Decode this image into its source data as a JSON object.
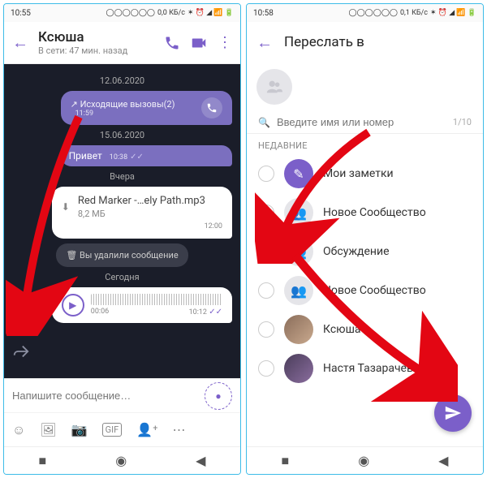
{
  "left": {
    "status": {
      "time": "10:55",
      "net": "0,0 КБ/с"
    },
    "chat_name": "Ксюша",
    "chat_sub": "В сети: 47 мин. назад",
    "dates": {
      "d1": "12.06.2020",
      "d2": "15.06.2020",
      "d3": "Вчера",
      "d4": "Сегодня"
    },
    "call": {
      "text": "Исходящие вызовы(2)",
      "time": "11:59"
    },
    "msg_hello": {
      "text": "Привет",
      "time": "10:38"
    },
    "file": {
      "name": "Red Marker -…ely Path.mp3",
      "size": "8,2 МБ",
      "time": "12:00"
    },
    "deleted": "Вы удалили сообщение",
    "voice": {
      "dur": "00:06",
      "time": "10:12"
    },
    "input_placeholder": "Напишите сообщение…"
  },
  "right": {
    "status": {
      "time": "10:58",
      "net": "0,1 КБ/с"
    },
    "title": "Переслать в",
    "search_placeholder": "Введите имя или номер",
    "count": "1/10",
    "section": "НЕДАВНИЕ",
    "rows": {
      "r1": "Мои заметки",
      "r2": "Новое Сообщество",
      "r3": "Обсуждение",
      "r4": "Новое Сообщество",
      "r5": "Ксюша",
      "r6": "Настя Тазарачева Теле2"
    }
  }
}
